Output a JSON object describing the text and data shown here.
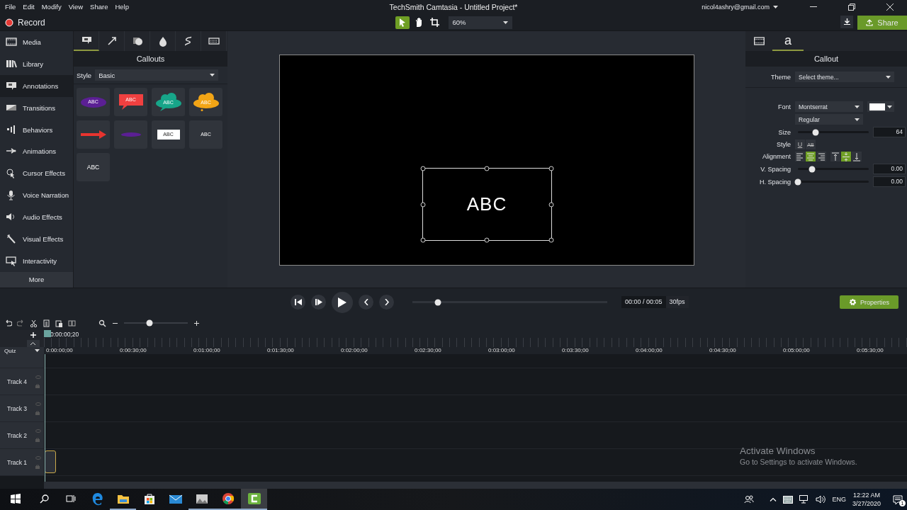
{
  "window": {
    "title": "TechSmith Camtasia - Untitled Project*",
    "account": "nicol4ashry@gmail.com"
  },
  "menu": [
    "File",
    "Edit",
    "Modify",
    "View",
    "Share",
    "Help"
  ],
  "toolbar": {
    "record": "Record",
    "zoom": "60%",
    "share": "Share",
    "tools": [
      {
        "kind": "pointer",
        "selected": true
      },
      {
        "kind": "hand",
        "selected": false
      },
      {
        "kind": "crop",
        "selected": false
      }
    ]
  },
  "sidebar": {
    "items": [
      {
        "kind": "media",
        "label": "Media",
        "selected": false
      },
      {
        "kind": "library",
        "label": "Library",
        "selected": false
      },
      {
        "kind": "annotations",
        "label": "Annotations",
        "selected": true
      },
      {
        "kind": "transitions",
        "label": "Transitions",
        "selected": false
      },
      {
        "kind": "behaviors",
        "label": "Behaviors",
        "selected": false
      },
      {
        "kind": "animations",
        "label": "Animations",
        "selected": false
      },
      {
        "kind": "cursor",
        "label": "Cursor Effects",
        "selected": false
      },
      {
        "kind": "voice",
        "label": "Voice Narration",
        "selected": false
      },
      {
        "kind": "audio",
        "label": "Audio Effects",
        "selected": false
      },
      {
        "kind": "visual",
        "label": "Visual Effects",
        "selected": false
      },
      {
        "kind": "interactivity",
        "label": "Interactivity",
        "selected": false
      }
    ],
    "more": "More"
  },
  "annotations": {
    "tabs": [
      {
        "kind": "callout",
        "selected": true
      },
      {
        "kind": "arrow",
        "selected": false
      },
      {
        "kind": "shape",
        "selected": false
      },
      {
        "kind": "blur",
        "selected": false
      },
      {
        "kind": "sketch",
        "selected": false
      },
      {
        "kind": "keystroke",
        "selected": false
      }
    ],
    "title": "Callouts",
    "style_label": "Style",
    "style_value": "Basic",
    "callouts": [
      {
        "kind": "oval",
        "color": "#5b1f94",
        "text": "ABC"
      },
      {
        "kind": "speech",
        "color": "#f04040",
        "text": "ABC"
      },
      {
        "kind": "cloud",
        "color": "#17a589",
        "text": "ABC"
      },
      {
        "kind": "thought",
        "color": "#f2a516",
        "text": "ABC"
      },
      {
        "kind": "arrow",
        "color": "#e8342f"
      },
      {
        "kind": "banner",
        "color": "#5b1f94"
      },
      {
        "kind": "box",
        "color": "#ffffff",
        "text": "ABC"
      },
      {
        "kind": "plain",
        "text": "ABC"
      },
      {
        "kind": "text",
        "text": "ABC"
      }
    ]
  },
  "canvas": {
    "text": "ABC"
  },
  "properties": {
    "tabs": [
      {
        "kind": "visual",
        "selected": false
      },
      {
        "kind": "text",
        "label": "a",
        "selected": true
      }
    ],
    "title": "Callout",
    "theme_label": "Theme",
    "theme_value": "Select theme...",
    "font_label": "Font",
    "font_value": "Montserrat",
    "weight_value": "Regular",
    "size_label": "Size",
    "size": {
      "level": 0.25,
      "value": "64"
    },
    "style_label": "Style",
    "styles": [
      {
        "kind": "underline",
        "label": "U",
        "on": false
      },
      {
        "kind": "strike",
        "label": "AB",
        "on": false
      }
    ],
    "alignment_label": "Alignment",
    "alignment": [
      {
        "kind": "left",
        "selected": false
      },
      {
        "kind": "center",
        "selected": true
      },
      {
        "kind": "right",
        "selected": false
      }
    ],
    "vertical_alignment": [
      {
        "kind": "top",
        "selected": false
      },
      {
        "kind": "middle",
        "selected": true
      },
      {
        "kind": "bottom",
        "selected": false
      }
    ],
    "v_spacing": {
      "label": "V. Spacing",
      "level": 0.2,
      "value": "0.00"
    },
    "h_spacing": {
      "label": "H. Spacing",
      "level": 0.0,
      "value": "0.00"
    }
  },
  "playback": {
    "scrub": {
      "level": 0.13
    },
    "time": "00:00 / 00:05",
    "fps": "30fps",
    "properties": "Properties"
  },
  "timeline": {
    "zoom": {
      "level": 0.4
    },
    "playhead": "0:00:00;20",
    "quiz": "Quiz",
    "ticks": [
      "0:00:00;00",
      "0:00:30;00",
      "0:01:00;00",
      "0:01:30;00",
      "0:02:00;00",
      "0:02:30;00",
      "0:03:00;00",
      "0:03:30;00",
      "0:04:00;00",
      "0:04:30;00",
      "0:05:00;00",
      "0:05:30;00"
    ],
    "tracks": [
      {
        "label": "Track 4",
        "clip": false
      },
      {
        "label": "Track 3",
        "clip": false
      },
      {
        "label": "Track 2",
        "clip": false
      },
      {
        "label": "Track 1",
        "clip": true
      }
    ]
  },
  "activation": {
    "title": "Activate Windows",
    "text": "Go to Settings to activate Windows."
  },
  "taskbar": {
    "apps": [
      {
        "kind": "edge",
        "running": false,
        "selected": false
      },
      {
        "kind": "explorer",
        "running": true,
        "selected": false
      },
      {
        "kind": "store",
        "running": false,
        "selected": false
      },
      {
        "kind": "mail",
        "running": false,
        "selected": false
      },
      {
        "kind": "photos",
        "running": true,
        "selected": false
      },
      {
        "kind": "chrome",
        "running": true,
        "selected": false
      },
      {
        "kind": "camtasia",
        "running": true,
        "selected": true
      }
    ],
    "language": "ENG",
    "time": "12:22 AM",
    "date": "3/27/2020",
    "notifications": "1"
  }
}
